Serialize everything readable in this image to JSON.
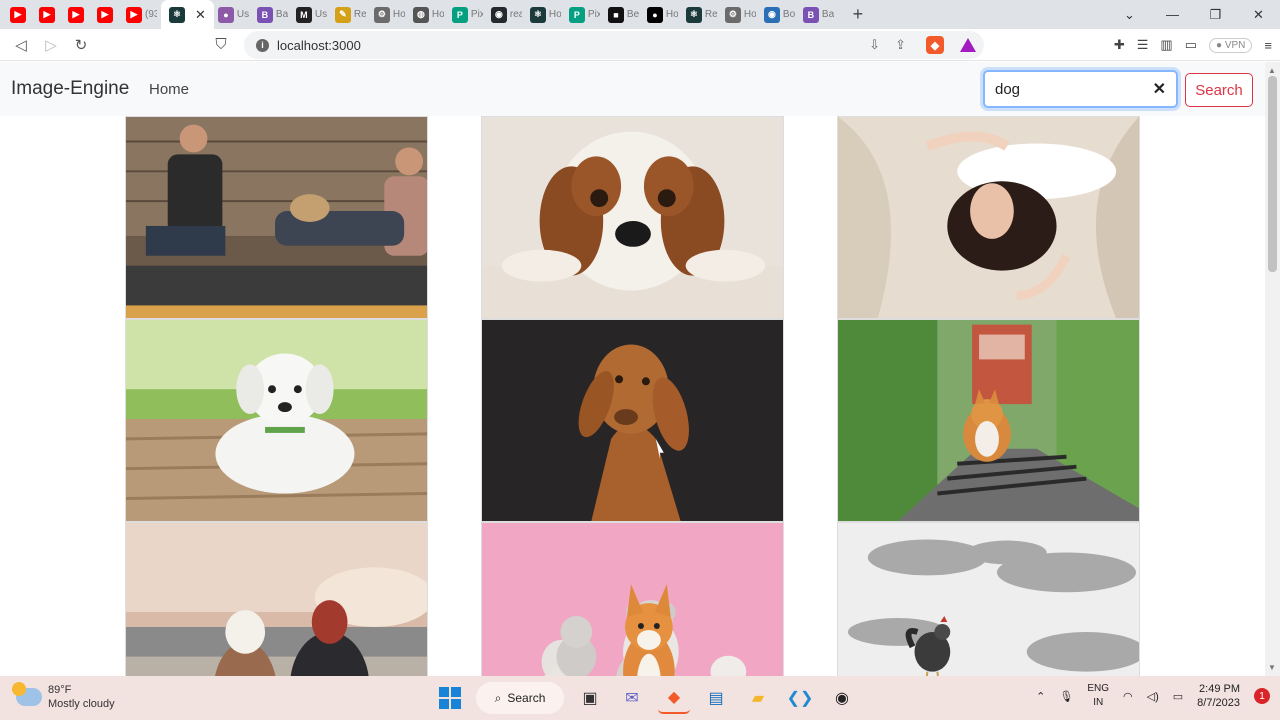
{
  "browser": {
    "tabs": [
      {
        "icon": "youtube-icon",
        "color": "#ff0000",
        "glyph": "▶",
        "title": ""
      },
      {
        "icon": "youtube-icon",
        "color": "#ff0000",
        "glyph": "▶",
        "title": ""
      },
      {
        "icon": "youtube-icon",
        "color": "#ff0000",
        "glyph": "▶",
        "title": ""
      },
      {
        "icon": "youtube-icon",
        "color": "#ff0000",
        "glyph": "▶",
        "title": ""
      },
      {
        "icon": "youtube-icon",
        "color": "#ff0000",
        "glyph": "▶",
        "title": "(93"
      },
      {
        "icon": "react-icon",
        "color": "#1b3a3c",
        "glyph": "⚛",
        "title": "",
        "active": true
      },
      {
        "icon": "avatar-icon",
        "color": "#8e5aa8",
        "glyph": "●",
        "title": "Usi"
      },
      {
        "icon": "bootstrap-icon",
        "color": "#7952b3",
        "glyph": "B",
        "title": "Bac"
      },
      {
        "icon": "mui-icon",
        "color": "#222222",
        "glyph": "M",
        "title": "Usi"
      },
      {
        "icon": "pen-icon",
        "color": "#d4a017",
        "glyph": "✎",
        "title": "Re"
      },
      {
        "icon": "tool-icon",
        "color": "#6b6b6b",
        "glyph": "⚙",
        "title": "Ho"
      },
      {
        "icon": "globe-icon",
        "color": "#555555",
        "glyph": "◍",
        "title": "Ho"
      },
      {
        "icon": "pexels-icon",
        "color": "#05a081",
        "glyph": "P",
        "title": "Pix"
      },
      {
        "icon": "github-icon",
        "color": "#24292e",
        "glyph": "◉",
        "title": "rea"
      },
      {
        "icon": "react-icon",
        "color": "#1b3a3c",
        "glyph": "⚛",
        "title": "Ho"
      },
      {
        "icon": "pexels-icon",
        "color": "#05a081",
        "glyph": "P",
        "title": "Pix"
      },
      {
        "icon": "unsplash-icon",
        "color": "#111111",
        "glyph": "■",
        "title": "Be"
      },
      {
        "icon": "medium-icon",
        "color": "#000000",
        "glyph": "●",
        "title": "Ho"
      },
      {
        "icon": "react-icon",
        "color": "#1b3a3c",
        "glyph": "⚛",
        "title": "Re"
      },
      {
        "icon": "tool-icon",
        "color": "#6b6b6b",
        "glyph": "⚙",
        "title": "Ho"
      },
      {
        "icon": "eye-icon",
        "color": "#2a6fb5",
        "glyph": "◉",
        "title": "Bo"
      },
      {
        "icon": "bootstrap-icon",
        "color": "#7952b3",
        "glyph": "B",
        "title": "Ba"
      }
    ],
    "url": "localhost:3000",
    "vpn_label": "VPN"
  },
  "app": {
    "brand": "Image-Engine",
    "nav_home": "Home",
    "search_value": "dog",
    "search_button": "Search"
  },
  "gallery": [
    {
      "name": "people-with-pug-image",
      "scene": "people"
    },
    {
      "name": "spaniel-puppy-image",
      "scene": "spaniel"
    },
    {
      "name": "woman-on-fur-image",
      "scene": "woman"
    },
    {
      "name": "white-puppy-image",
      "scene": "puppy"
    },
    {
      "name": "vizsla-dog-image",
      "scene": "vizsla"
    },
    {
      "name": "corgi-on-railway-image",
      "scene": "corgi"
    },
    {
      "name": "dog-and-woman-sunset-image",
      "scene": "sunset"
    },
    {
      "name": "pets-pink-background-image",
      "scene": "pets"
    },
    {
      "name": "rooster-image",
      "scene": "rooster"
    }
  ],
  "taskbar": {
    "temperature": "89°F",
    "weather": "Mostly cloudy",
    "search_label": "Search",
    "lang_top": "ENG",
    "lang_bottom": "IN",
    "time": "2:49 PM",
    "date": "8/7/2023",
    "notification_count": "1"
  }
}
